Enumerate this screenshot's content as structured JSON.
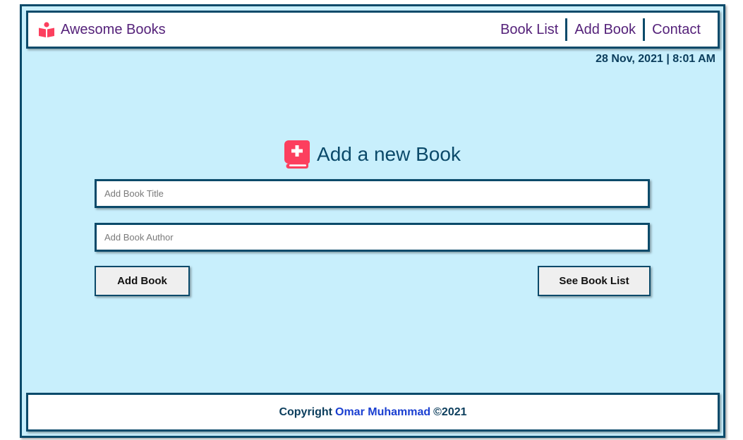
{
  "header": {
    "brand": "Awesome Books",
    "brand_icon": "book-reader-icon",
    "nav": [
      {
        "label": "Book List"
      },
      {
        "label": "Add Book"
      },
      {
        "label": "Contact"
      }
    ]
  },
  "datetime": "28 Nov, 2021 | 8:01 AM",
  "form": {
    "title": "Add a new Book",
    "title_icon": "book-medical-icon",
    "title_placeholder": "Add Book Title",
    "author_placeholder": "Add Book Author",
    "add_button": "Add Book",
    "see_list_button": "See Book List"
  },
  "footer": {
    "prefix": "Copyright",
    "author": "Omar Muhammad",
    "suffix": "©2021"
  },
  "colors": {
    "background": "#c8effc",
    "border": "#0b4a6a",
    "nav_text": "#55227a",
    "icon_accent": "#fc3f5e",
    "link": "#1a3fd1"
  }
}
